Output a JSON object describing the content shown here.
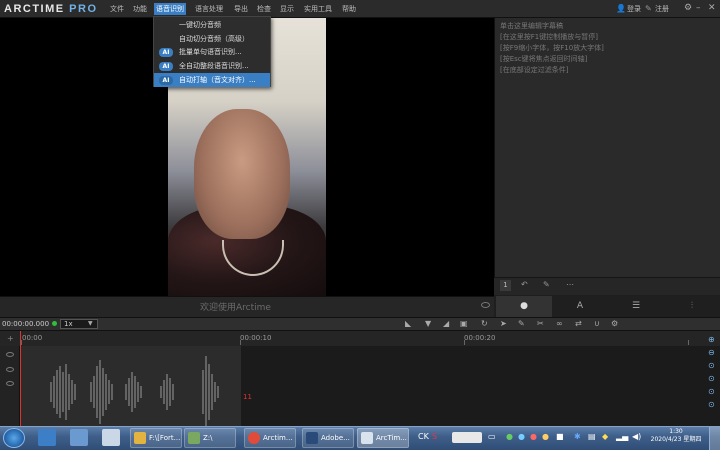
{
  "app": {
    "logo_main": "ARCTIME",
    "logo_pro": "PRO"
  },
  "menu": {
    "items": [
      "文件",
      "功能",
      "语音识别",
      "语言处理",
      "导出",
      "检查",
      "显示",
      "实用工具",
      "帮助"
    ],
    "active": "语音识别"
  },
  "topright": {
    "login": "登录",
    "register": "注册"
  },
  "dropdown": {
    "items": [
      {
        "label": "一键切分音频",
        "ai": false
      },
      {
        "label": "自动切分音频（高级）",
        "ai": false
      },
      {
        "label": "批量单句语音识别...",
        "ai": true
      },
      {
        "label": "全自动整段语音识别...",
        "ai": true
      },
      {
        "label": "自动打轴（音文对齐）...",
        "ai": true
      }
    ],
    "ai_badge": "AI"
  },
  "video": {
    "welcome": "欢迎使用Arctime"
  },
  "right_panel": {
    "tips": [
      "单击这里编辑字幕稿",
      "[在这里按F1键控制播放与暂停]",
      "[按F9缩小字体，按F10放大字体]",
      "[按Esc键将焦点返回时间轴]",
      "[在底部设定过滤条件]"
    ],
    "badge": "1"
  },
  "timeline": {
    "timecode": "00:00:00.000",
    "speed": "1x",
    "ruler": [
      "00:00",
      "00:00:10",
      "00:00:20"
    ],
    "wave_marker": "11"
  },
  "taskbar": {
    "buttons": [
      {
        "label": "F:\\[Fort...",
        "color": "#e3b341"
      },
      {
        "label": "Z:\\",
        "color": "#7aa860"
      },
      {
        "label": "Arctim...",
        "color": "#e04b3a"
      },
      {
        "label": "Adobe...",
        "color": "#2a4a7a"
      },
      {
        "label": "ArcTim...",
        "color": "#d9e3ee"
      }
    ],
    "clock_time": "1:30",
    "clock_date": "2020/4/23 星期四"
  },
  "colors": {
    "accent": "#3a7fc4",
    "playhead": "#dd3333",
    "record": "#2fbf3a"
  }
}
